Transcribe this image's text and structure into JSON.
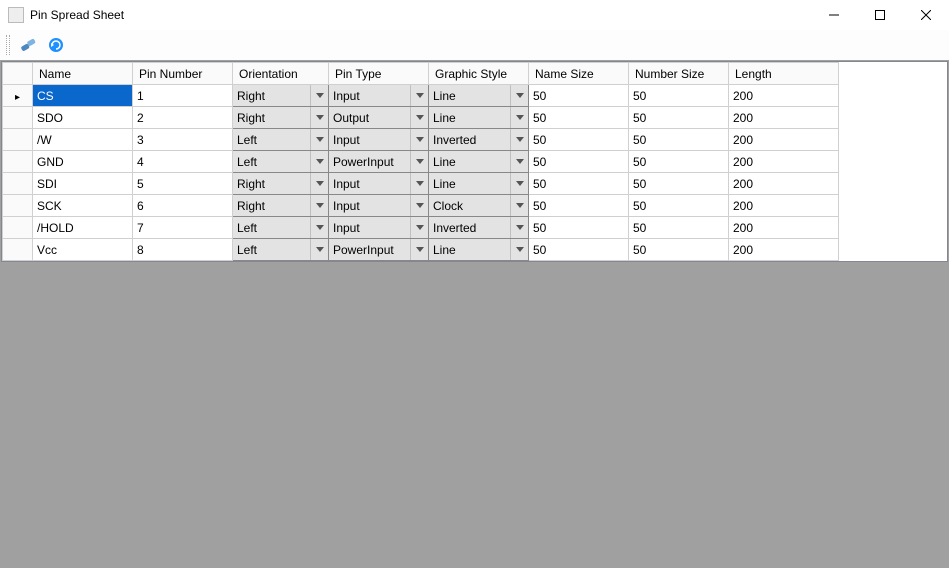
{
  "window": {
    "title": "Pin Spread Sheet"
  },
  "toolbar": {
    "btn1_name": "link-icon",
    "btn2_name": "refresh-icon"
  },
  "grid": {
    "columns": [
      "Name",
      "Pin Number",
      "Orientation",
      "Pin Type",
      "Graphic Style",
      "Name Size",
      "Number Size",
      "Length"
    ],
    "selected_row": 0,
    "rows": [
      {
        "name": "CS",
        "pin": "1",
        "orient": "Right",
        "ptype": "Input",
        "gstyle": "Line",
        "nsize": "50",
        "numsize": "50",
        "length": "200"
      },
      {
        "name": "SDO",
        "pin": "2",
        "orient": "Right",
        "ptype": "Output",
        "gstyle": "Line",
        "nsize": "50",
        "numsize": "50",
        "length": "200"
      },
      {
        "name": "/W",
        "pin": "3",
        "orient": "Left",
        "ptype": "Input",
        "gstyle": "Inverted",
        "nsize": "50",
        "numsize": "50",
        "length": "200"
      },
      {
        "name": "GND",
        "pin": "4",
        "orient": "Left",
        "ptype": "PowerInput",
        "gstyle": "Line",
        "nsize": "50",
        "numsize": "50",
        "length": "200"
      },
      {
        "name": "SDI",
        "pin": "5",
        "orient": "Right",
        "ptype": "Input",
        "gstyle": "Line",
        "nsize": "50",
        "numsize": "50",
        "length": "200"
      },
      {
        "name": "SCK",
        "pin": "6",
        "orient": "Right",
        "ptype": "Input",
        "gstyle": "Clock",
        "nsize": "50",
        "numsize": "50",
        "length": "200"
      },
      {
        "name": "/HOLD",
        "pin": "7",
        "orient": "Left",
        "ptype": "Input",
        "gstyle": "Inverted",
        "nsize": "50",
        "numsize": "50",
        "length": "200"
      },
      {
        "name": "Vcc",
        "pin": "8",
        "orient": "Left",
        "ptype": "PowerInput",
        "gstyle": "Line",
        "nsize": "50",
        "numsize": "50",
        "length": "200"
      }
    ]
  }
}
